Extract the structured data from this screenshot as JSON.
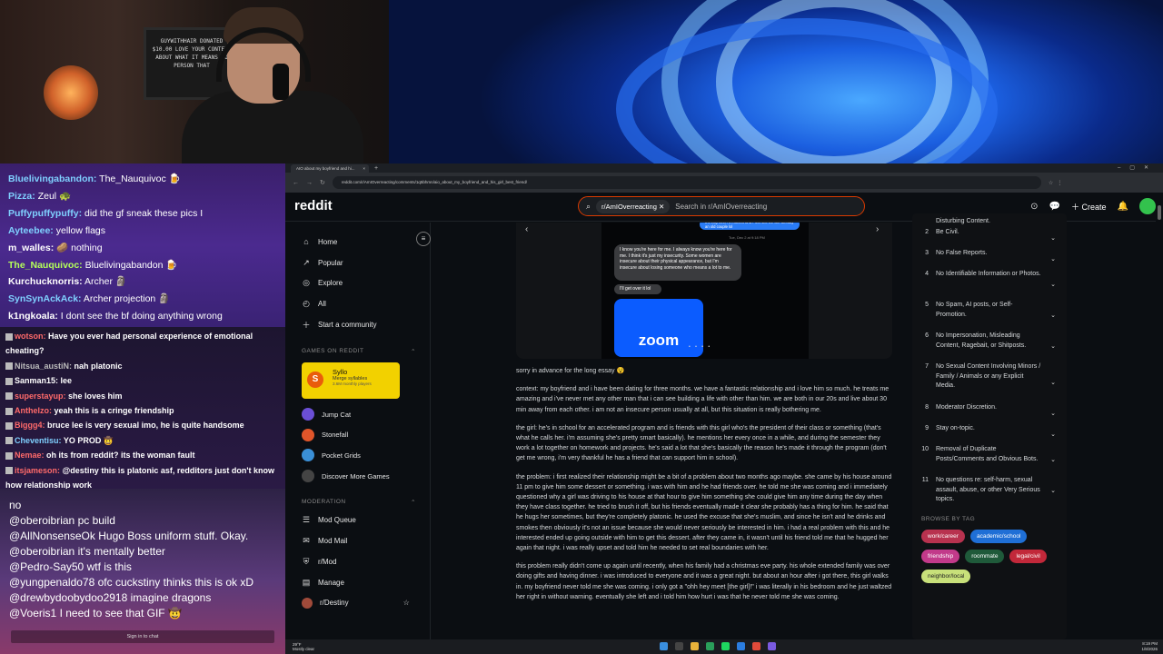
{
  "chat_top": [
    {
      "user": "Bluelivingabandon:",
      "user_color": "#7fd0ff",
      "text": "The_Nauquivoc 🍺"
    },
    {
      "user": "Pizza:",
      "user_color": "#7fd0ff",
      "text": "Zeul 🐢"
    },
    {
      "user": "Puffypuffypuffy:",
      "user_color": "#7fd0ff",
      "text": "did the gf sneak these pics I"
    },
    {
      "user": "Ayteebee:",
      "user_color": "#7fd0ff",
      "text": "yellow flags"
    },
    {
      "user": "m_walles:",
      "user_color": "#ffffff",
      "text": "🥔 nothing"
    },
    {
      "user": "The_Nauquivoc:",
      "user_color": "#b4ff5a",
      "text": "Bluelivingabandon 🍺"
    },
    {
      "user": "Kurchucknorris:",
      "user_color": "#ffffff",
      "text": "Archer 🗿"
    },
    {
      "user": "SynSynAckAck:",
      "user_color": "#7fd0ff",
      "text": "Archer projection 🗿"
    },
    {
      "user": "k1ngkoala:",
      "user_color": "#ffffff",
      "text": "I dont see the bf doing anything wrong"
    }
  ],
  "chat_mid": [
    {
      "user": "wotson:",
      "user_color": "#ff6a6a",
      "text": "Have you ever had personal experience of emotional cheating?"
    },
    {
      "user": "Nitsua_austiN:",
      "user_color": "#bbbbbb",
      "text": "nah platonic"
    },
    {
      "user": "Sanman15:",
      "user_color": "#ffffff",
      "text": "lee"
    },
    {
      "user": "superstayup:",
      "user_color": "#ff6a6a",
      "text": "she loves him"
    },
    {
      "user": "Anthelzo:",
      "user_color": "#ff6a6a",
      "text": "yeah this is a cringe friendship"
    },
    {
      "user": "Biggg4:",
      "user_color": "#ff6a6a",
      "text": "bruce lee is very sexual imo, he is quite handsome"
    },
    {
      "user": "Cheventisu:",
      "user_color": "#7fd0ff",
      "text": "YO PROD 🤠"
    },
    {
      "user": "Nemae:",
      "user_color": "#ff6a6a",
      "text": "oh its from reddit? its the woman fault"
    },
    {
      "user": "itsjameson:",
      "user_color": "#ff6a6a",
      "text": "@destiny this is platonic asf, redditors just don't know how relationship work"
    }
  ],
  "chat_bot": [
    {
      "user": "",
      "text": "no"
    },
    {
      "user": "@oberoibrian",
      "text": "pc build"
    },
    {
      "user": "@AllNonsenseOk",
      "text": "Hugo Boss uniform stuff. Okay."
    },
    {
      "user": "@oberoibrian",
      "text": "it's mentally better"
    },
    {
      "user": "@Pedro-Say50",
      "text": "wtf is this"
    },
    {
      "user": "@yungpenaldo78",
      "text": "ofc cuckstiny thinks this is ok xD"
    },
    {
      "user": "@drewbydoobydoo2918",
      "text": "imagine dragons"
    },
    {
      "user": "@Voeris1",
      "text": "I need to see that GIF 🤠"
    }
  ],
  "chat_signin": "Sign in to chat",
  "webcam": {
    "board_text": "GUYWITHHAIR DONATED $10.00 LOVE YOUR CONTENT ABOUT WHAT IT MEANS TO PERSON THAT"
  },
  "browser": {
    "tab_title": "AIO about my boyfriend and hi...",
    "url": "reddit.com/r/AmIOverreacting/comments/1q5bhmn/aio_about_my_boyfriend_and_his_girl_best_friend/"
  },
  "reddit": {
    "logo": "reddit",
    "search_chip": "r/AmIOverreacting",
    "search_placeholder": "Search in r/AmIOverreacting",
    "create_label": "Create",
    "notif_count": "21"
  },
  "left_nav": {
    "items": [
      "Home",
      "Popular",
      "Explore",
      "All",
      "Start a community"
    ],
    "games_header": "GAMES ON REDDIT",
    "featured_game": {
      "name": "Syllo",
      "subtitle": "Merge syllables",
      "players": "3.6M monthly players"
    },
    "games": [
      "Jump Cat",
      "Stonefall",
      "Pocket Grids",
      "Discover More Games"
    ],
    "moderation_header": "MODERATION",
    "mod_items": [
      "Mod Queue",
      "Mod Mail",
      "r/Mod",
      "Manage",
      "r/Destiny"
    ]
  },
  "post": {
    "bubble_top": "It's only been 6 months and I feel like we are already an old couple lol",
    "timestamp": "Tue, Dec 2 at 9:18 PM",
    "bubble_main": "I know you're here for me. I always know you're here for me. I think it's just my insecurity. Some women are insecure about their physical appearance, but I'm insecure about losing someone who means a lot to me.",
    "bubble_small": "I'll get over it lol",
    "zoom_label": "zoom",
    "paragraphs": [
      "sorry in advance for the long essay 😵",
      "context: my boyfriend and i have been dating for three months. we have a fantastic relationship and i love him so much. he treats me amazing and i've never met any other man that i can see building a life with other than him. we are both in our 20s and live about 30 min away from each other. i am not an insecure person usually at all, but this situation is really bothering me.",
      "the girl: he's in school for an accelerated program and is friends with this girl who's the president of their class or something (that's what he calls her. i'm assuming she's pretty smart basically). he mentions her every once in a while, and during the semester they work a lot together on homework and projects. he's said a lot that she's basically the reason he's made it through the program (don't get me wrong, i'm very thankful he has a friend that can support him in school).",
      "the problem: i first realized their relationship might be a bit of a problem about two months ago maybe. she came by his house around 11 pm to give him some dessert or something. i was with him and he had friends over. he told me she was coming and i immediately questioned why a girl was driving to his house at that hour to give him something she could give him any time during the day when they have class together. he tried to brush it off, but his friends eventually made it clear she probably has a thing for him. he said that he hugs her sometimes, but they're completely platonic. he used the excuse that she's muslim, and since he isn't and he drinks and smokes then obviously it's not an issue because she would never seriously be interested in him. i had a real problem with this and he interested ended up going outside with him to get this dessert. after they came in, it wasn't until his friend told me that he hugged her again that night. i was really upset and told him he needed to set real boundaries with her.",
      "this problem really didn't come up again until recently, when his family had a christmas eve party. his whole extended family was over doing gifts and having dinner. i was introduced to everyone and it was a great night. but about an hour after i got there, this girl walks in. my boyfriend never told me she was coming. i only got a \"ohh hey meet [the girl]!\" i was literally in his bedroom and he just waltzed her right in without warning. eventually she left and i told him how hurt i was that he never told me she was coming."
    ]
  },
  "rules": [
    {
      "num": "",
      "text": "Disturbing Content."
    },
    {
      "num": "2",
      "text": "Be Civil."
    },
    {
      "num": "3",
      "text": "No False Reports."
    },
    {
      "num": "4",
      "text": "No Identifiable Information or Photos."
    },
    {
      "num": "5",
      "text": "No Spam, AI posts, or Self-Promotion."
    },
    {
      "num": "6",
      "text": "No Impersonation, Misleading Content, Ragebait, or Shitposts."
    },
    {
      "num": "7",
      "text": "No Sexual Content Involving Minors / Family / Animals or any Explicit Media."
    },
    {
      "num": "8",
      "text": "Moderator Discretion."
    },
    {
      "num": "9",
      "text": "Stay on-topic."
    },
    {
      "num": "10",
      "text": "Removal of Duplicate Posts/Comments and Obvious Bots."
    },
    {
      "num": "11",
      "text": "No questions re: self-harm, sexual assault, abuse, or other Very Serious topics."
    }
  ],
  "tags_title": "BROWSE BY TAG",
  "tags": [
    {
      "label": "work/career",
      "color": "#b8324f"
    },
    {
      "label": "academic/school",
      "color": "#1f6fd6"
    },
    {
      "label": "friendship",
      "color": "#c23a8a"
    },
    {
      "label": "roommate",
      "color": "#1f5a3a"
    },
    {
      "label": "legal/civil",
      "color": "#c2283a"
    },
    {
      "label": "neighbor/local",
      "color": "#c8e07a"
    }
  ],
  "taskbar": {
    "weather_temp": "29°F",
    "weather_desc": "Mostly clear",
    "time": "8:19 PM",
    "date": "1/8/2026"
  }
}
